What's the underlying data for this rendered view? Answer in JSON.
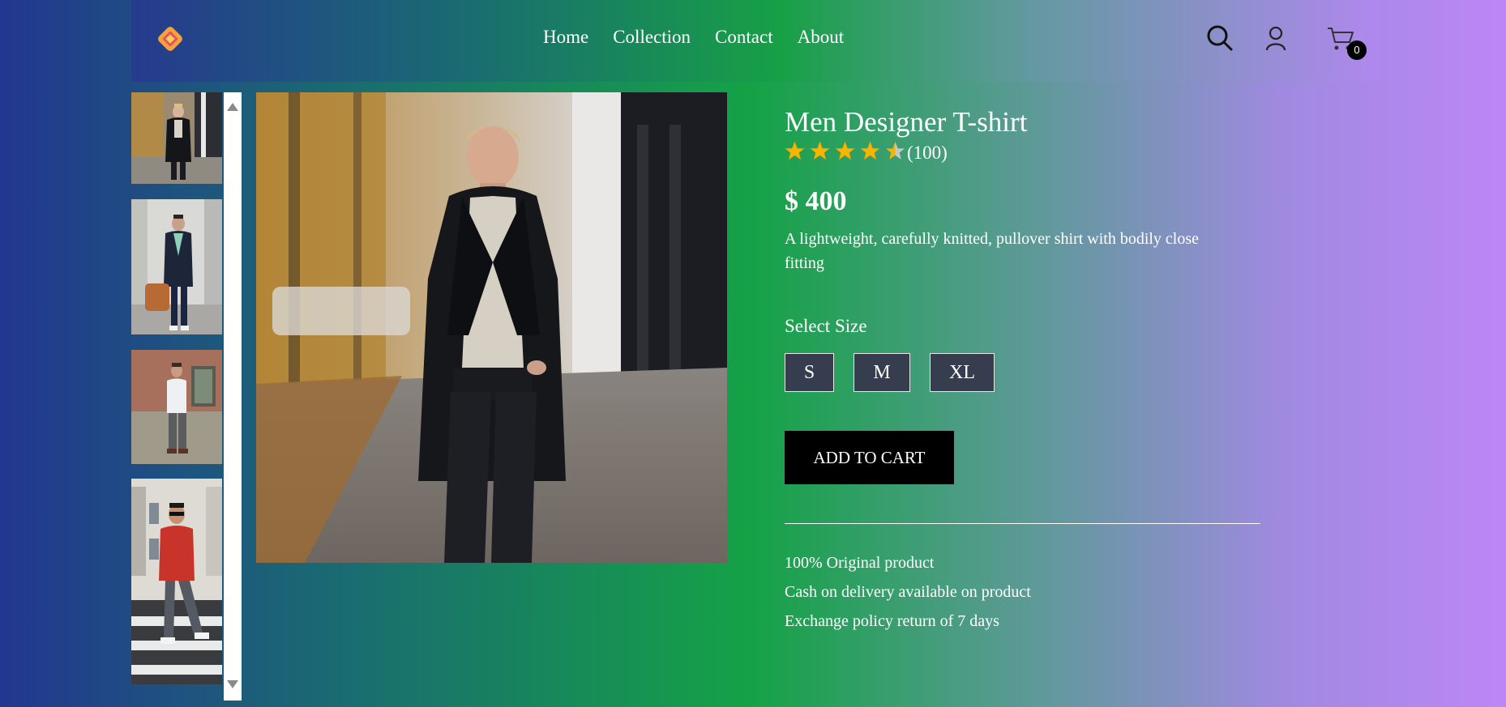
{
  "nav": {
    "links": [
      "Home",
      "Collection",
      "Contact",
      "About"
    ],
    "cart_count": "0",
    "icons": [
      "logo-icon",
      "search-icon",
      "user-icon",
      "cart-icon"
    ]
  },
  "gallery": {
    "thumbnails": [
      "man-black-coat",
      "man-navy-coat-bag",
      "man-white-shirt-brick-wall",
      "man-red-sweater-crosswalk"
    ],
    "main_image": "man-black-coat-street"
  },
  "product": {
    "title": "Men Designer T-shirt",
    "rating_value": 4.5,
    "rating_max": 5,
    "review_count": "(100)",
    "price": "$ 400",
    "description": "A lightweight, carefully knitted, pullover shirt with bodily close fitting",
    "size_label": "Select Size",
    "sizes": [
      "S",
      "M",
      "XL"
    ],
    "add_to_cart_label": "ADD TO CART",
    "features": [
      "100% Original product",
      "Cash on delivery available on product",
      "Exchange policy return of 7 days"
    ]
  },
  "colors": {
    "star_fill": "#f5b500",
    "button_bg": "#000000",
    "size_bg": "#353d4f"
  }
}
